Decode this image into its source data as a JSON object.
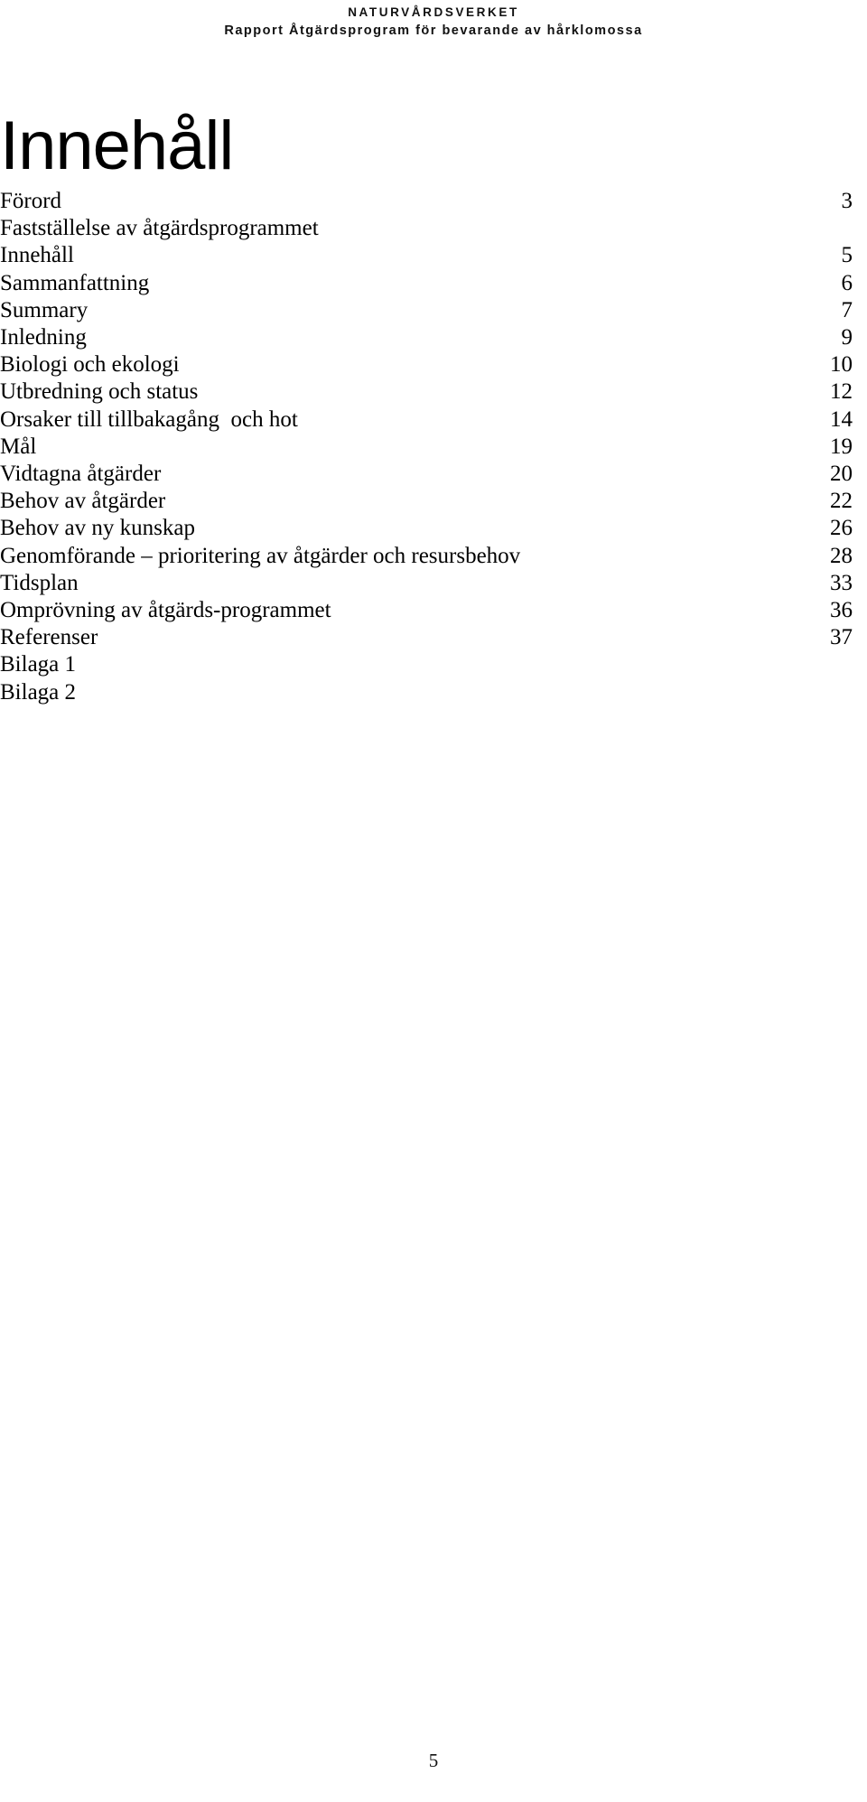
{
  "running_head": {
    "organization": "NATURVÅRDSVERKET",
    "report_line": "Rapport Åtgärdsprogram för bevarande av hårklomossa"
  },
  "page_title": "Innehåll",
  "toc": {
    "entries": [
      {
        "label": "Förord",
        "page": "3"
      },
      {
        "label": "Fastställelse av åtgärdsprogrammet",
        "page": ""
      },
      {
        "label": "Innehåll",
        "page": "5"
      },
      {
        "label": "Sammanfattning",
        "page": "6"
      },
      {
        "label": "Summary",
        "page": "7"
      },
      {
        "label": "Inledning",
        "page": "9"
      },
      {
        "label": "Biologi och ekologi",
        "page": "10"
      },
      {
        "label": "Utbredning och status",
        "page": "12"
      },
      {
        "label": "Orsaker till tillbakagång  och hot",
        "page": "14"
      },
      {
        "label": "Mål",
        "page": "19"
      },
      {
        "label": "Vidtagna åtgärder",
        "page": "20"
      },
      {
        "label": "Behov av åtgärder",
        "page": "22"
      },
      {
        "label": "Behov av ny kunskap",
        "page": "26"
      },
      {
        "label": "Genomförande – prioritering av åtgärder och resursbehov",
        "page": "28"
      },
      {
        "label": "Tidsplan",
        "page": "33"
      },
      {
        "label": "Omprövning av åtgärds-programmet",
        "page": "36"
      },
      {
        "label": "Referenser",
        "page": "37"
      },
      {
        "label": "Bilaga 1",
        "page": ""
      },
      {
        "label": "Bilaga 2",
        "page": ""
      }
    ]
  },
  "folio": "5",
  "colors": {
    "text": "#000000",
    "background": "#ffffff"
  }
}
